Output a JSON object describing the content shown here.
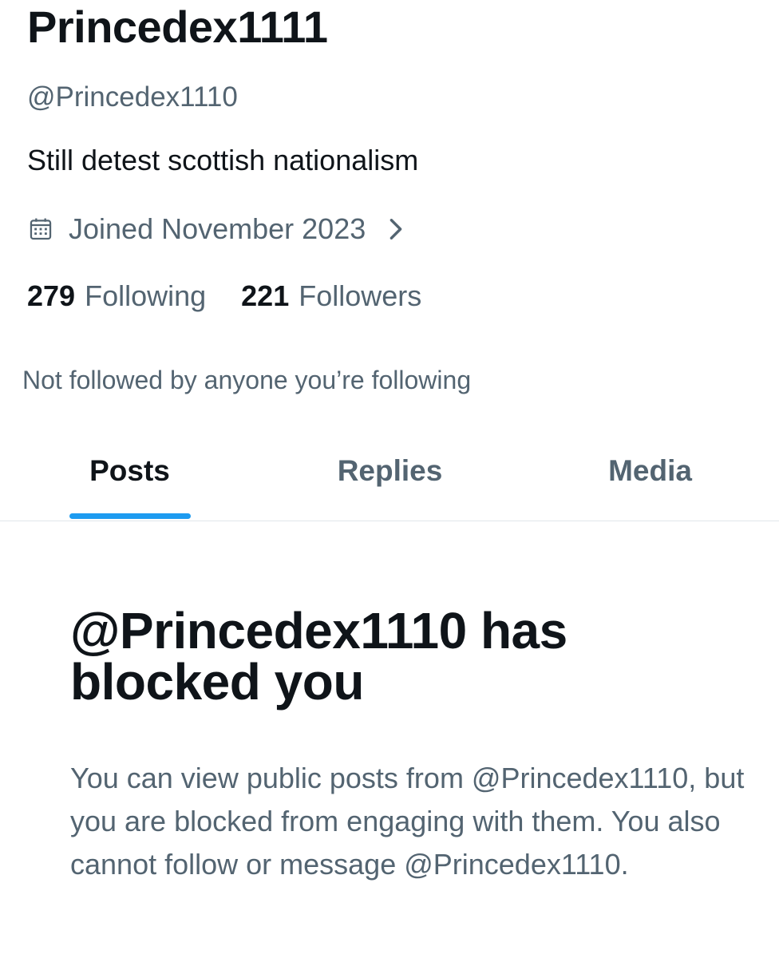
{
  "profile": {
    "display_name": "Princedex1111",
    "handle": "@Princedex1110",
    "bio": "Still detest scottish nationalism",
    "joined": "Joined November 2023",
    "following_count": "279",
    "following_label": "Following",
    "followers_count": "221",
    "followers_label": "Followers",
    "not_followed_note": "Not followed by anyone you’re following"
  },
  "tabs": [
    {
      "label": "Posts",
      "active": true
    },
    {
      "label": "Replies",
      "active": false
    },
    {
      "label": "Media",
      "active": false
    }
  ],
  "blocked": {
    "title": "@Princedex1110 has blocked you",
    "description": "You can view public posts from @Princedex1110, but you are blocked from engaging with them. You also cannot follow or message @Princedex1110."
  },
  "icons": {
    "joined": "calendar-icon",
    "expand": "chevron-right-icon"
  },
  "colors": {
    "accent": "#1d9bf0",
    "primary_text": "#0f1419",
    "secondary_text": "#536471",
    "divider": "#e1e6ea"
  }
}
